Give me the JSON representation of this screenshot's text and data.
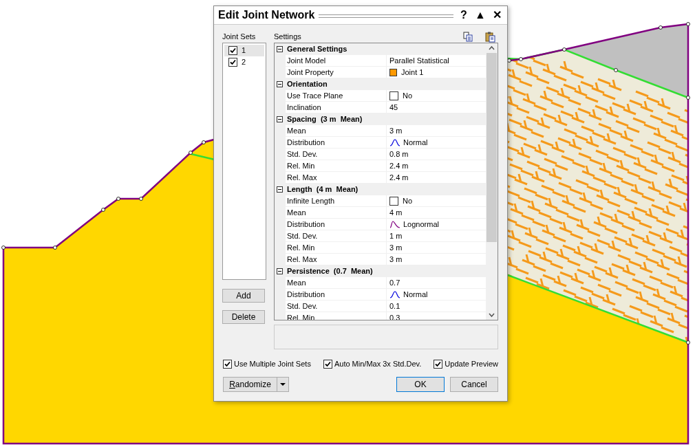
{
  "window": {
    "title": "Edit Joint Network",
    "title_buttons": [
      "?",
      "▲",
      "✕"
    ]
  },
  "joint_sets": {
    "label": "Joint Sets",
    "items": [
      {
        "label": "1",
        "checked": true,
        "selected": true
      },
      {
        "label": "2",
        "checked": true,
        "selected": false
      }
    ],
    "buttons": [
      "Add",
      "Delete"
    ]
  },
  "settings": {
    "label": "Settings",
    "groups": [
      {
        "title": "General Settings",
        "expanded": true,
        "rows": [
          {
            "name": "Joint Model",
            "kind": "text",
            "value": "Parallel Statistical"
          },
          {
            "name": "Joint Property",
            "kind": "swatch",
            "color": "#ff9900",
            "value": "Joint 1"
          }
        ]
      },
      {
        "title": "Orientation",
        "expanded": true,
        "rows": [
          {
            "name": "Use Trace Plane",
            "kind": "checkbox",
            "checked": false,
            "value": "No"
          },
          {
            "name": "Inclination",
            "kind": "text",
            "value": "45"
          }
        ]
      },
      {
        "title": "Spacing  (3 m  Mean)",
        "expanded": true,
        "rows": [
          {
            "name": "Mean",
            "kind": "text",
            "value": "3 m"
          },
          {
            "name": "Distribution",
            "kind": "normal",
            "value": "Normal"
          },
          {
            "name": "Std. Dev.",
            "kind": "text",
            "value": "0.8 m"
          },
          {
            "name": "Rel. Min",
            "kind": "text",
            "value": "2.4 m"
          },
          {
            "name": "Rel. Max",
            "kind": "text",
            "value": "2.4 m"
          }
        ]
      },
      {
        "title": "Length  (4 m  Mean)",
        "expanded": true,
        "rows": [
          {
            "name": "Infinite Length",
            "kind": "checkbox",
            "checked": false,
            "value": "No"
          },
          {
            "name": "Mean",
            "kind": "text",
            "value": "4 m"
          },
          {
            "name": "Distribution",
            "kind": "lognormal",
            "value": "Lognormal"
          },
          {
            "name": "Std. Dev.",
            "kind": "text",
            "value": "1 m"
          },
          {
            "name": "Rel. Min",
            "kind": "text",
            "value": "3 m"
          },
          {
            "name": "Rel. Max",
            "kind": "text",
            "value": "3 m"
          }
        ]
      },
      {
        "title": "Persistence  (0.7  Mean)",
        "expanded": true,
        "rows": [
          {
            "name": "Mean",
            "kind": "text",
            "value": "0.7"
          },
          {
            "name": "Distribution",
            "kind": "normal",
            "value": "Normal"
          },
          {
            "name": "Std. Dev.",
            "kind": "text",
            "value": "0.1"
          },
          {
            "name": "Rel. Min",
            "kind": "text",
            "value": "0.3"
          }
        ]
      }
    ]
  },
  "options": [
    {
      "label": "Use Multiple Joint Sets",
      "checked": true
    },
    {
      "label": "Auto Min/Max 3x Std.Dev.",
      "checked": true
    },
    {
      "label": "Update Preview",
      "checked": true
    }
  ],
  "randomize": {
    "label": "Randomize",
    "underline_first": true
  },
  "buttons": [
    {
      "label": "OK",
      "default": true
    },
    {
      "label": "Cancel",
      "default": false
    }
  ]
}
